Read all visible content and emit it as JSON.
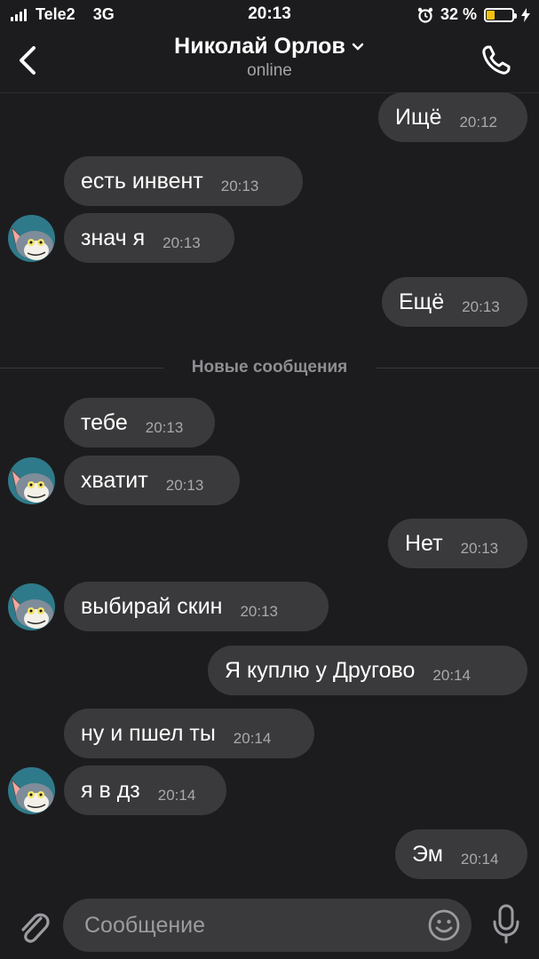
{
  "status_bar": {
    "carrier": "Tele2",
    "network": "3G",
    "time": "20:13",
    "battery_percent": "32 %",
    "battery_level": 0.32
  },
  "header": {
    "contact_name": "Николай Орлов",
    "status": "online"
  },
  "messages": [
    {
      "text": "Ищё",
      "time": "20:12",
      "outgoing": true
    },
    {
      "text": "есть инвент",
      "time": "20:13",
      "outgoing": false
    },
    {
      "text": "знач я",
      "time": "20:13",
      "outgoing": false,
      "avatar": true
    },
    {
      "text": "Ещё",
      "time": "20:13",
      "outgoing": true
    },
    {
      "text": "тебе",
      "time": "20:13",
      "outgoing": false
    },
    {
      "text": "хватит",
      "time": "20:13",
      "outgoing": false,
      "avatar": true
    },
    {
      "text": "Нет",
      "time": "20:13",
      "outgoing": true
    },
    {
      "text": "выбирай скин",
      "time": "20:13",
      "outgoing": false,
      "avatar": true
    },
    {
      "text": "Я куплю у Другово",
      "time": "20:14",
      "outgoing": true
    },
    {
      "text": "ну и пшел ты",
      "time": "20:14",
      "outgoing": false
    },
    {
      "text": "я в дз",
      "time": "20:14",
      "outgoing": false,
      "avatar": true
    },
    {
      "text": "Эм",
      "time": "20:14",
      "outgoing": true
    }
  ],
  "divider": {
    "label": "Новые сообщения"
  },
  "input": {
    "placeholder": "Сообщение"
  },
  "icons": {
    "back": "chevron-left-icon",
    "chevron": "chevron-down-icon",
    "call": "phone-icon",
    "attach": "paperclip-icon",
    "emoji": "smiley-icon",
    "mic": "microphone-icon",
    "alarm": "alarm-clock-icon",
    "charging": "lightning-icon"
  },
  "colors": {
    "background": "#1c1c1e",
    "bubble": "#3a3a3c",
    "battery": "#f4c20d"
  }
}
